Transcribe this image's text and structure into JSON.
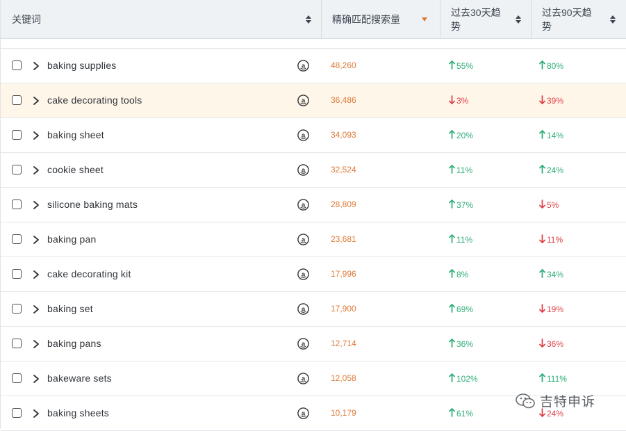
{
  "header": {
    "keyword": "关键词",
    "volume": "精确匹配搜索量",
    "trend30_l1": "过去30天趋",
    "trend30_l2": "势",
    "trend90_l1": "过去90天趋",
    "trend90_l2": "势"
  },
  "colors": {
    "accent": "#e07b39",
    "positive": "#2eae76",
    "negative": "#e0404a",
    "highlight": "#fff6ea"
  },
  "rows": [
    {
      "keyword": "baking supplies",
      "volume": "48,260",
      "t30": "55%",
      "t30_dir": "up",
      "t90": "80%",
      "t90_dir": "up"
    },
    {
      "keyword": "cake decorating tools",
      "volume": "36,486",
      "t30": "3%",
      "t30_dir": "down",
      "t90": "39%",
      "t90_dir": "down",
      "highlighted": true
    },
    {
      "keyword": "baking sheet",
      "volume": "34,093",
      "t30": "20%",
      "t30_dir": "up",
      "t90": "14%",
      "t90_dir": "up"
    },
    {
      "keyword": "cookie sheet",
      "volume": "32,524",
      "t30": "11%",
      "t30_dir": "up",
      "t90": "24%",
      "t90_dir": "up"
    },
    {
      "keyword": "silicone baking mats",
      "volume": "28,809",
      "t30": "37%",
      "t30_dir": "up",
      "t90": "5%",
      "t90_dir": "down"
    },
    {
      "keyword": "baking pan",
      "volume": "23,681",
      "t30": "11%",
      "t30_dir": "up",
      "t90": "11%",
      "t90_dir": "down"
    },
    {
      "keyword": "cake decorating kit",
      "volume": "17,996",
      "t30": "8%",
      "t30_dir": "up",
      "t90": "34%",
      "t90_dir": "up"
    },
    {
      "keyword": "baking set",
      "volume": "17,900",
      "t30": "69%",
      "t30_dir": "up",
      "t90": "19%",
      "t90_dir": "down"
    },
    {
      "keyword": "baking pans",
      "volume": "12,714",
      "t30": "36%",
      "t30_dir": "up",
      "t90": "36%",
      "t90_dir": "down"
    },
    {
      "keyword": "bakeware sets",
      "volume": "12,058",
      "t30": "102%",
      "t30_dir": "up",
      "t90": "111%",
      "t90_dir": "up"
    },
    {
      "keyword": "baking sheets",
      "volume": "10,179",
      "t30": "61%",
      "t30_dir": "up",
      "t90": "24%",
      "t90_dir": "down"
    }
  ],
  "icons": {
    "row_expand": "chevron-right-icon",
    "marketplace": "amazon-icon",
    "watermark": "wechat-icon"
  },
  "watermark": {
    "text": "吉特申诉"
  }
}
